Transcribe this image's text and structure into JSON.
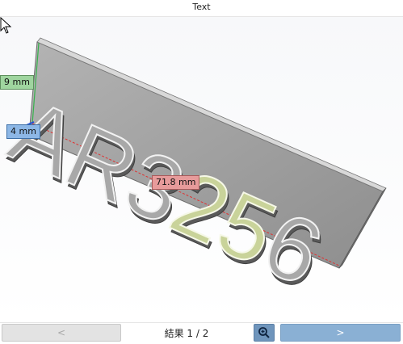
{
  "window": {
    "title": "Text"
  },
  "model": {
    "text_prefix": "AR3",
    "text_highlight": "25",
    "text_suffix": "6"
  },
  "dimensions": {
    "height_label": "9 mm",
    "depth_label": "4 mm",
    "width_label": "71.8 mm"
  },
  "navigation": {
    "prev_label": "<",
    "next_label": ">",
    "result_label": "結果 1 / 2",
    "zoom_icon": "zoom-in-icon"
  },
  "colors": {
    "accent_blue": "#8ab0d4",
    "highlight_text": "#c9d39a",
    "plate": "#9c9c9c",
    "height_tag": "#9fd59f",
    "depth_tag": "#8db7e6",
    "width_tag": "#e79b9b"
  }
}
